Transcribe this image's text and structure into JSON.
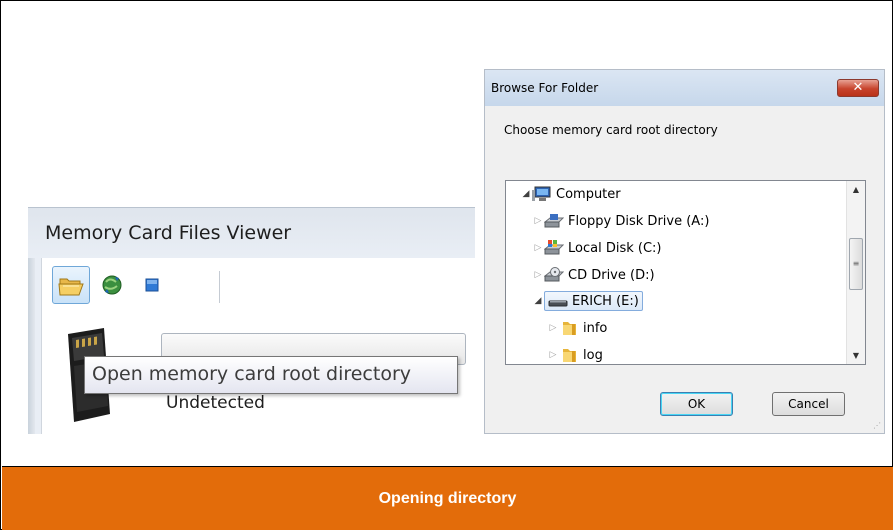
{
  "app": {
    "title": "Memory Card Files Viewer",
    "tooltip": "Open memory card root directory",
    "status": "Undetected",
    "toolbar": [
      {
        "icon": "open-folder-icon"
      },
      {
        "icon": "refresh-globe-icon"
      },
      {
        "icon": "stop-icon"
      }
    ]
  },
  "dialog": {
    "title": "Browse For Folder",
    "close_label": "✕",
    "prompt": "Choose memory card root directory",
    "tree": [
      {
        "label": "Computer",
        "icon": "computer-icon",
        "expanded": true
      },
      {
        "label": "Floppy Disk Drive (A:)",
        "icon": "floppy-drive-icon"
      },
      {
        "label": "Local Disk (C:)",
        "icon": "local-disk-icon"
      },
      {
        "label": "CD Drive (D:)",
        "icon": "cd-drive-icon"
      },
      {
        "label": "ERICH (E:)",
        "icon": "removable-drive-icon",
        "expanded": true,
        "selected": true
      },
      {
        "label": "info",
        "icon": "folder-icon"
      },
      {
        "label": "log",
        "icon": "folder-icon"
      }
    ],
    "ok_label": "OK",
    "cancel_label": "Cancel"
  },
  "caption": "Opening directory",
  "colors": {
    "caption_bg": "#e36c0a",
    "caption_text": "#ffffff"
  }
}
